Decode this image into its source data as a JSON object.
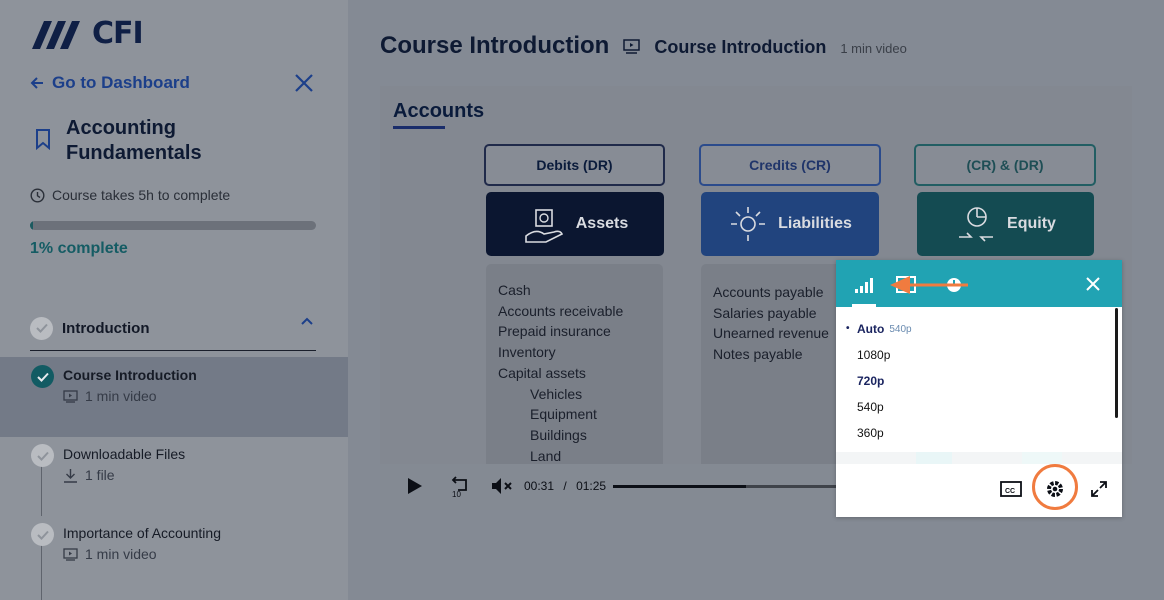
{
  "logo": {
    "text": "CFI"
  },
  "sidebar": {
    "goto_label": "Go to Dashboard",
    "course_title": "Accounting Fundamentals",
    "duration": "Course takes 5h to complete",
    "progress_pct": 1,
    "progress_text": "1% complete",
    "section": "Introduction",
    "lessons": [
      {
        "title": "Course Introduction",
        "meta": "1 min video",
        "done": true,
        "active": true
      },
      {
        "title": "Downloadable Files",
        "meta": "1 file",
        "done": false,
        "active": false
      },
      {
        "title": "Importance of Accounting",
        "meta": "1 min video",
        "done": false,
        "active": false
      }
    ]
  },
  "main": {
    "title": "Course Introduction",
    "subtitle": "Course Introduction",
    "meta": "1 min video"
  },
  "slide": {
    "heading": "Accounts",
    "headers": [
      "Debits (DR)",
      "Credits (CR)",
      "(CR) & (DR)"
    ],
    "tiles": [
      "Assets",
      "Liabilities",
      "Equity"
    ],
    "assets_list": [
      "Cash",
      "Accounts receivable",
      "Prepaid insurance",
      "Inventory",
      "Capital assets"
    ],
    "assets_sub": [
      "Vehicles",
      "Equipment",
      "Buildings",
      "Land"
    ],
    "liab_list": [
      "Accounts payable",
      "Salaries payable",
      "Unearned revenue",
      "Notes payable"
    ]
  },
  "player": {
    "current_time": "00:31",
    "separator": "/",
    "duration": "01:25",
    "played_fraction": 0.365,
    "buffered_fraction": 0.69
  },
  "quality_menu": {
    "current": "Auto",
    "current_res": "540p",
    "options": [
      "1080p",
      "720p",
      "540p",
      "360p"
    ],
    "selected": "720p"
  },
  "colors": {
    "teal": "#21a3b3",
    "annotation": "#f07b3f"
  }
}
